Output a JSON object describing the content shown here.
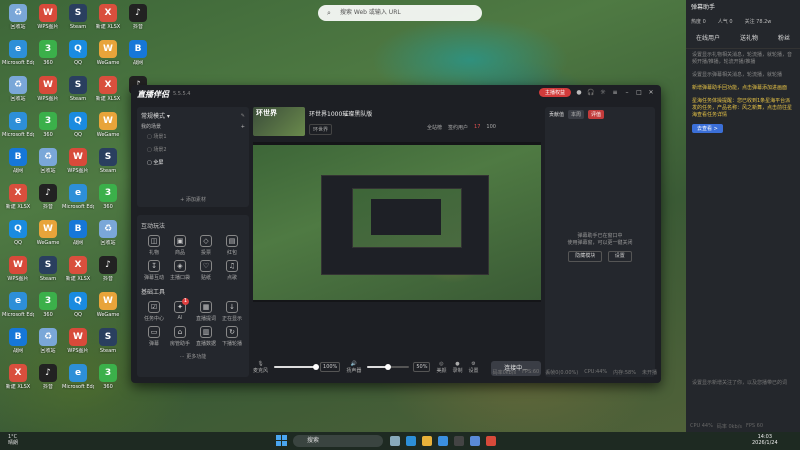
{
  "browser_search": {
    "placeholder": "搜索 Web 或输入 URL"
  },
  "desktop_icons": [
    {
      "label": "回收站",
      "glyph": "♻",
      "color": "#7aa7d8"
    },
    {
      "label": "WPS图片",
      "glyph": "W",
      "color": "#d84a3a"
    },
    {
      "label": "Steam",
      "glyph": "S",
      "color": "#2a3f5f"
    },
    {
      "label": "新建 XLSX",
      "glyph": "X",
      "color": "#d94f3d"
    },
    {
      "label": "抖音",
      "glyph": "♪",
      "color": "#222"
    },
    {
      "label": "Microsoft Edge",
      "glyph": "e",
      "color": "#2d8fd8"
    },
    {
      "label": "360",
      "glyph": "3",
      "color": "#3bb04a"
    },
    {
      "label": "QQ",
      "glyph": "Q",
      "color": "#1a8be0"
    },
    {
      "label": "WeGame",
      "glyph": "W",
      "color": "#e8a43a"
    },
    {
      "label": "战网",
      "glyph": "B",
      "color": "#1677d8"
    }
  ],
  "app": {
    "logo": "直播伴侣",
    "version": "5.5.5.4",
    "open_live": "主播权益",
    "menu": [
      "开播提醒",
      "分享"
    ],
    "scene_mode": "常规模式",
    "scene_header": "我的场景",
    "scene_items": [
      "场景1",
      "场景2",
      "全屏"
    ],
    "add_source": "添加素材",
    "interact_title": "互动玩法",
    "interact_tools": [
      "礼物",
      "商品",
      "投票",
      "红包",
      "弹幕互动",
      "主播口袋",
      "贴纸",
      "点歌"
    ],
    "basic_title": "基础工具",
    "basic_tools": [
      "任务中心",
      "AI",
      "直播提词",
      "正在显示",
      "弹幕",
      "房管助手",
      "直播数据",
      "下播轮播"
    ],
    "ai_badge": "1",
    "more_tools": "更多功能",
    "stream_title": "环世界1000璀璨黑队版",
    "thumb_text": "环世界",
    "tag": "环世界",
    "stats": {
      "watch": "全站榜",
      "rank": "签约用户",
      "rank_val": "17",
      "likes": "100"
    },
    "mic_label": "麦克风",
    "mic_pct": "100%",
    "speaker_label": "扬声器",
    "speaker_pct": "50%",
    "ctl_labels": [
      "美颜",
      "录制",
      "设置"
    ],
    "connect_btn": "连接中...",
    "status": [
      "码率0kb/s",
      "FPS:60",
      "丢帧0(0.00%)",
      "CPU:44%",
      "内存:58%",
      "未开播"
    ],
    "right_panel": {
      "tab1": "贡献值",
      "tab2": "本周",
      "tab3": "评值",
      "tip1": "弹幕助手已在窗口中",
      "tip2": "使用弹幕窗，可以更一键关闭",
      "btn1": "隐藏模块",
      "btn2": "设置"
    }
  },
  "helper": {
    "title": "弹幕助手",
    "stats": {
      "hot": "热度 0",
      "people": "人气 0",
      "follow": "关注 78.2w"
    },
    "tabs": [
      "在线用户",
      "送礼物",
      "粉丝"
    ],
    "msgs": [
      {
        "text": "设置显示礼物相关消息，轮流播，就轮播，音频开播/推播，轮流开播/推播",
        "style": "grey"
      },
      {
        "text": "设置显示弹幕相关消息，轮流播，就轮播",
        "style": "grey"
      },
      {
        "text": "新增弹幕助手回功能，点击弹幕添加进画面",
        "style": "yellow"
      },
      {
        "text": "星海任务体操提醒：您已收到1条星海平台派发的任务，产品名称：风之新舞，点击前往星海查看任务详情",
        "style": "yellow"
      }
    ],
    "btn": "去查看 >",
    "bottom_tip": "设置显示新增关注了你，以及您播带已的词",
    "foot": [
      "CPU 44%",
      "码率 0kb/s",
      "FPS 60"
    ]
  },
  "taskbar": {
    "weather": "1°C",
    "weather_desc": "晴朗",
    "search": "搜索",
    "time": "14:03",
    "date": "2026/1/24"
  }
}
